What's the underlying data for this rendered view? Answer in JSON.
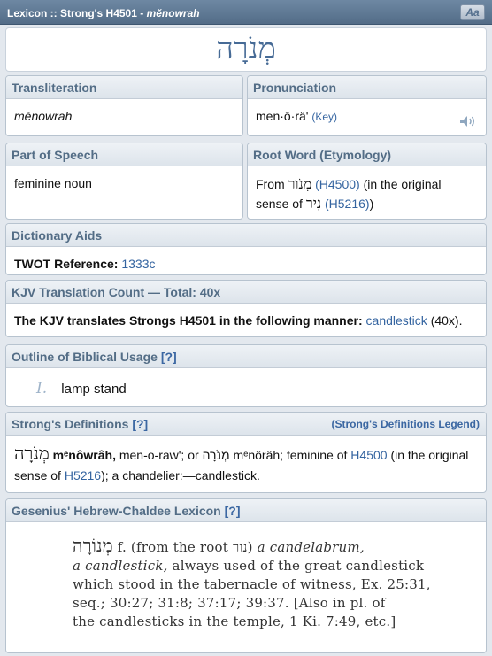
{
  "titlebar": {
    "prefix": "Lexicon :: Strong's H4501 - ",
    "translit": "mĕnowrah",
    "aa_button": "Aa"
  },
  "headword": "מְנֹרָה",
  "transliteration": {
    "label": "Transliteration",
    "value": "mĕnowrah"
  },
  "pronunciation": {
    "label": "Pronunciation",
    "value": "men·ō·rä'",
    "key_link": "(Key)",
    "icon": "speaker-icon"
  },
  "part_of_speech": {
    "label": "Part of Speech",
    "value": "feminine noun"
  },
  "root_word": {
    "label": "Root Word (Etymology)",
    "from": "From",
    "heb1": "מְנֹור",
    "ref1": "(H4500)",
    "mid": "(in the original",
    "sense": "sense of",
    "heb2": "נִיר",
    "ref2": "(H5216)",
    "end": ")"
  },
  "dictionary_aids": {
    "label": "Dictionary Aids",
    "twot_label": "TWOT Reference:",
    "twot_value": "1333c"
  },
  "kjv": {
    "label": "KJV Translation Count — Total: 40x",
    "text": "The KJV translates Strongs H4501 in the following manner:",
    "word": "candlestick",
    "count": "(40x)."
  },
  "outline": {
    "label": "Outline of Biblical Usage",
    "qm": "[?]",
    "numeral": "I.",
    "item": "lamp stand"
  },
  "strongs": {
    "label": "Strong's Definitions",
    "qm": "[?]",
    "legend": "(Strong's Definitions Legend)",
    "heb": "מְנֹרָה",
    "translit": "mᵉnôwrâh,",
    "line1_rest": "men-o-raw'; or מְנֹרָה mᵉnôrâh; feminine of",
    "ref1": "H4500",
    "line1_end": "(in the",
    "line2_start": "original sense of",
    "ref2": "H5216",
    "line2_end": "); a chandelier:—candlestick."
  },
  "gesenius": {
    "label": "Gesenius' Hebrew-Chaldee Lexicon",
    "qm": "[?]",
    "heb": "מְנוֹרָה",
    "l1a": "f. (from the root",
    "l1heb": "נור",
    "l1b": ")",
    "l1it": "a candelabrum,",
    "l2it": "a candlestick,",
    "l2": "always used of the great candlestick",
    "l3": "which stood in the tabernacle of witness, Ex. 25:31,",
    "l4": "seq.; 30:27; 31:8; 37:17; 39:37.  [Also in pl. of",
    "l5": "the candlesticks in the temple, 1 Ki. 7:49, etc.]"
  }
}
